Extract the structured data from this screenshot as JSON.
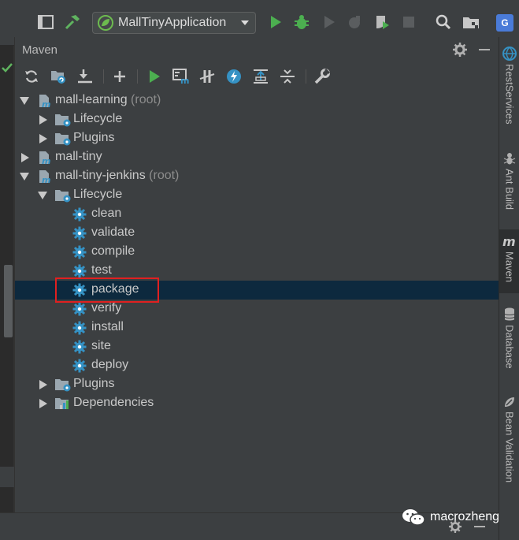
{
  "toolbar": {
    "run_config_label": "MallTinyApplication"
  },
  "panel": {
    "title": "Maven"
  },
  "tree": [
    {
      "label": "mall-learning",
      "suffix": "(root)",
      "type": "module",
      "expanded": true
    },
    {
      "label": "Lifecycle",
      "suffix": "",
      "type": "folder",
      "expanded": false
    },
    {
      "label": "Plugins",
      "suffix": "",
      "type": "folder",
      "expanded": false
    },
    {
      "label": "mall-tiny",
      "suffix": "",
      "type": "module",
      "expanded": false
    },
    {
      "label": "mall-tiny-jenkins",
      "suffix": "(root)",
      "type": "module",
      "expanded": true
    },
    {
      "label": "Lifecycle",
      "suffix": "",
      "type": "folder",
      "expanded": true
    },
    {
      "label": "clean",
      "suffix": "",
      "type": "goal"
    },
    {
      "label": "validate",
      "suffix": "",
      "type": "goal"
    },
    {
      "label": "compile",
      "suffix": "",
      "type": "goal"
    },
    {
      "label": "test",
      "suffix": "",
      "type": "goal"
    },
    {
      "label": "package",
      "suffix": "",
      "type": "goal",
      "selected": true
    },
    {
      "label": "verify",
      "suffix": "",
      "type": "goal"
    },
    {
      "label": "install",
      "suffix": "",
      "type": "goal"
    },
    {
      "label": "site",
      "suffix": "",
      "type": "goal"
    },
    {
      "label": "deploy",
      "suffix": "",
      "type": "goal"
    },
    {
      "label": "Plugins",
      "suffix": "",
      "type": "folder",
      "expanded": false
    },
    {
      "label": "Dependencies",
      "suffix": "",
      "type": "deps",
      "expanded": false
    }
  ],
  "right_tabs": [
    {
      "label": "RestServices",
      "icon": "globe-icon"
    },
    {
      "label": "Ant Build",
      "icon": "ant-icon"
    },
    {
      "label": "Maven",
      "icon": "maven-icon",
      "active": true
    },
    {
      "label": "Database",
      "icon": "database-icon"
    },
    {
      "label": "Bean Validation",
      "icon": "bean-validation-icon"
    }
  ],
  "corner_badge": "G",
  "watermark": {
    "text": "macrozheng"
  },
  "colors": {
    "background": "#3c3f41",
    "selection": "#0d293e",
    "highlight_border": "#e02020",
    "run_green": "#4caf50",
    "gear_blue": "#3592c4"
  }
}
